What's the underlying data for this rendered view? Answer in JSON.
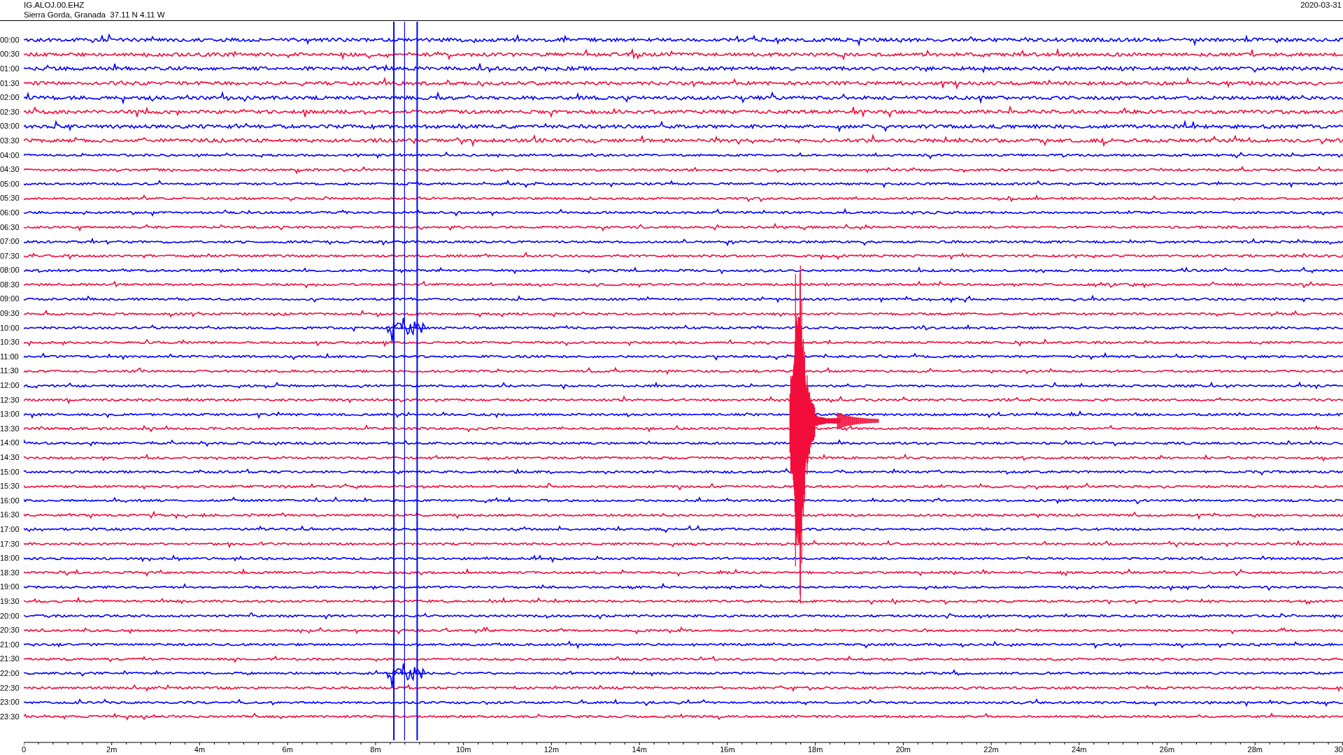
{
  "header": {
    "station": "IG.ALOJ.00.EHZ",
    "location": "Sierra Gorda, Granada  37.11 N 4.11 W",
    "date": "2020-03-31"
  },
  "rows": [
    {
      "time": "00:00",
      "color": "#0000ff"
    },
    {
      "time": "00:30",
      "color": "#f20d3a"
    },
    {
      "time": "01:00",
      "color": "#0000ff"
    },
    {
      "time": "01:30",
      "color": "#f20d3a"
    },
    {
      "time": "02:00",
      "color": "#0000ff"
    },
    {
      "time": "02:30",
      "color": "#f20d3a"
    },
    {
      "time": "03:00",
      "color": "#0000ff"
    },
    {
      "time": "03:30",
      "color": "#f20d3a"
    },
    {
      "time": "04:00",
      "color": "#0000ff"
    },
    {
      "time": "04:30",
      "color": "#f20d3a"
    },
    {
      "time": "05:00",
      "color": "#0000ff"
    },
    {
      "time": "05:30",
      "color": "#f20d3a"
    },
    {
      "time": "06:00",
      "color": "#0000ff"
    },
    {
      "time": "06:30",
      "color": "#f20d3a"
    },
    {
      "time": "07:00",
      "color": "#0000ff"
    },
    {
      "time": "07:30",
      "color": "#f20d3a"
    },
    {
      "time": "08:00",
      "color": "#0000ff"
    },
    {
      "time": "08:30",
      "color": "#f20d3a"
    },
    {
      "time": "09:00",
      "color": "#0000ff"
    },
    {
      "time": "09:30",
      "color": "#f20d3a"
    },
    {
      "time": "10:00",
      "color": "#0000ff"
    },
    {
      "time": "10:30",
      "color": "#f20d3a"
    },
    {
      "time": "11:00",
      "color": "#0000ff"
    },
    {
      "time": "11:30",
      "color": "#f20d3a"
    },
    {
      "time": "12:00",
      "color": "#0000ff"
    },
    {
      "time": "12:30",
      "color": "#f20d3a"
    },
    {
      "time": "13:00",
      "color": "#0000ff"
    },
    {
      "time": "13:30",
      "color": "#f20d3a"
    },
    {
      "time": "14:00",
      "color": "#0000ff"
    },
    {
      "time": "14:30",
      "color": "#f20d3a"
    },
    {
      "time": "15:00",
      "color": "#0000ff"
    },
    {
      "time": "15:30",
      "color": "#f20d3a"
    },
    {
      "time": "16:00",
      "color": "#0000ff"
    },
    {
      "time": "16:30",
      "color": "#f20d3a"
    },
    {
      "time": "17:00",
      "color": "#0000ff"
    },
    {
      "time": "17:30",
      "color": "#f20d3a"
    },
    {
      "time": "18:00",
      "color": "#0000ff"
    },
    {
      "time": "18:30",
      "color": "#f20d3a"
    },
    {
      "time": "19:00",
      "color": "#0000ff"
    },
    {
      "time": "19:30",
      "color": "#f20d3a"
    },
    {
      "time": "20:00",
      "color": "#0000ff"
    },
    {
      "time": "20:30",
      "color": "#f20d3a"
    },
    {
      "time": "21:00",
      "color": "#0000ff"
    },
    {
      "time": "21:30",
      "color": "#f20d3a"
    },
    {
      "time": "22:00",
      "color": "#0000ff"
    },
    {
      "time": "22:30",
      "color": "#f20d3a"
    },
    {
      "time": "23:00",
      "color": "#0000ff"
    },
    {
      "time": "23:30",
      "color": "#f20d3a"
    }
  ],
  "x_axis": {
    "ticks": [
      "0",
      "2m",
      "4m",
      "6m",
      "8m",
      "10m",
      "12m",
      "14m",
      "16m",
      "18m",
      "20m",
      "22m",
      "24m",
      "26m",
      "28m",
      "30"
    ]
  }
}
